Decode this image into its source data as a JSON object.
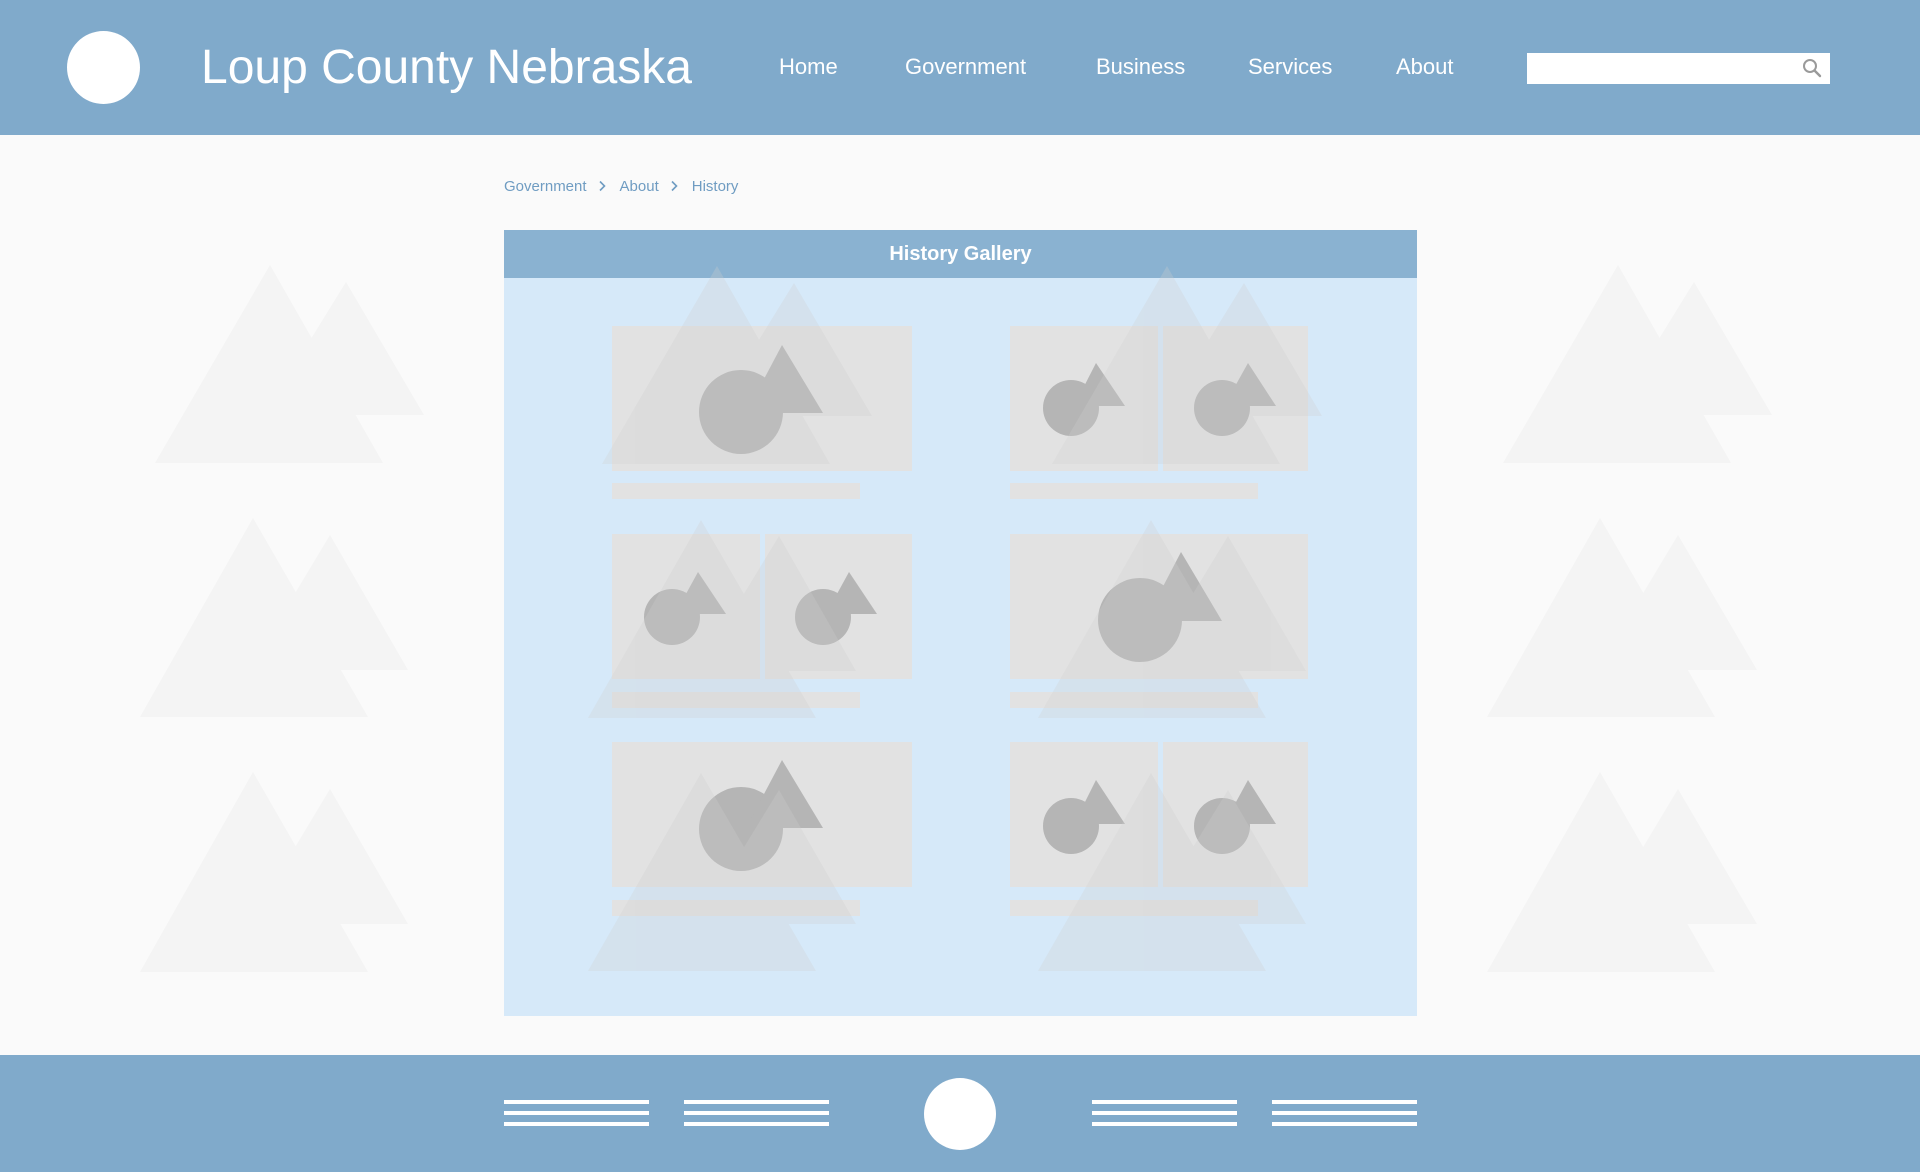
{
  "header": {
    "site_title": "Loup County Nebraska",
    "nav": [
      {
        "label": "Home"
      },
      {
        "label": "Government"
      },
      {
        "label": "Business"
      },
      {
        "label": "Services"
      },
      {
        "label": "About"
      }
    ],
    "search": {
      "value": "",
      "placeholder": "",
      "icon": "search-icon"
    }
  },
  "breadcrumb": {
    "items": [
      "Government",
      "About",
      "History"
    ],
    "separator_icon": "chevron-right-icon"
  },
  "gallery": {
    "title": "History Gallery",
    "items": [
      {
        "layout": "single-image"
      },
      {
        "layout": "two-images"
      },
      {
        "layout": "two-images"
      },
      {
        "layout": "single-image"
      },
      {
        "layout": "single-image"
      },
      {
        "layout": "two-images"
      }
    ]
  },
  "footer": {
    "link_blocks": 4
  },
  "colors": {
    "header_bg": "#80aacb",
    "footer_bg": "#80aacb",
    "page_bg": "#fafafa",
    "gallery_bg": "#d4e8f9",
    "gallery_header_bg": "#8db1cf",
    "breadcrumb_text": "#6f9cc2",
    "placeholder_fill": "#e2e2e2",
    "placeholder_shape": "#b5b5b5"
  }
}
